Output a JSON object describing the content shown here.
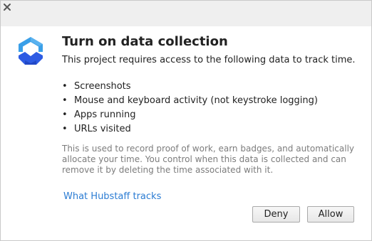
{
  "window": {
    "close_icon": "close-icon"
  },
  "header": {
    "logo_icon": "hubstaff-logo-icon",
    "title": "Turn on data collection",
    "subtitle": "This project requires access to the following data to track time."
  },
  "data_items": [
    "Screenshots",
    "Mouse and keyboard activity (not keystroke logging)",
    "Apps running",
    "URLs visited"
  ],
  "explanation_lines": [
    "This is used to record proof of work, earn badges, and automatically",
    "allocate your time. You control when this data is collected and can",
    "remove it by deleting the time associated with it."
  ],
  "link": {
    "label": "What Hubstaff tracks"
  },
  "buttons": {
    "deny": "Deny",
    "allow": "Allow"
  },
  "colors": {
    "logo_light_blue": "#3a9fe8",
    "logo_dark_blue": "#2d5be3",
    "link": "#2b7cd3",
    "muted_text": "#7c7c7c"
  }
}
